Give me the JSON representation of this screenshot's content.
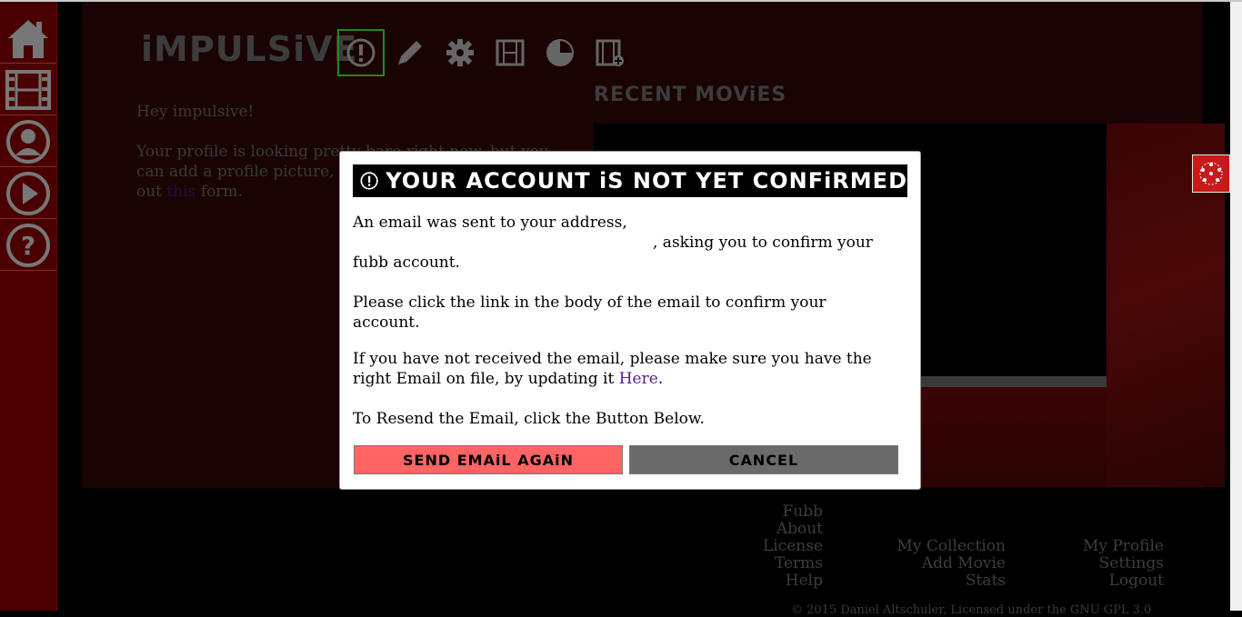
{
  "sidebar": {
    "items": [
      {
        "icon": "home-icon"
      },
      {
        "icon": "film-icon"
      },
      {
        "icon": "user-icon"
      },
      {
        "icon": "play-icon"
      },
      {
        "icon": "help-icon"
      }
    ]
  },
  "header": {
    "logo_text": "iMPULSiVE",
    "nav": [
      {
        "icon": "alert-icon",
        "active": true
      },
      {
        "icon": "pencil-icon"
      },
      {
        "icon": "gear-icon"
      },
      {
        "icon": "film-icon"
      },
      {
        "icon": "pie-chart-icon"
      },
      {
        "icon": "add-film-icon"
      }
    ]
  },
  "main": {
    "greeting": "Hey impulsive!",
    "profile_msg_1": "Your profile is looking pretty bare right now, but you can add a profile picture,",
    "profile_msg_link": "this",
    "profile_msg_pre": "out",
    "profile_msg_post": "form.",
    "recent_title": "RECENT MOViES"
  },
  "modal": {
    "title": "YOUR ACCOUNT iS NOT YET CONFiRMED",
    "p1_line1": "An email was sent to your address,",
    "p1_line2": ", asking you to confirm your",
    "p1_line3": "fubb account.",
    "p2": "Please click the link in the body of the email to confirm your account.",
    "p3_pre": "If you have not received the email, please make sure you have the right Email on file, by updating it",
    "p3_link": "Here",
    "p3_post": ".",
    "p4": "To Resend the Email, click the Button Below.",
    "send_label": "SEND EMAiL AGAiN",
    "cancel_label": "CANCEL"
  },
  "footer": {
    "col1": [
      "Fubb",
      "About",
      "License",
      "Terms",
      "Help"
    ],
    "col2": [
      "My Collection",
      "Add Movie",
      "Stats"
    ],
    "col3": [
      "My Profile",
      "Settings",
      "Logout"
    ],
    "copyright": "© 2015 Daniel Altschuler, Licensed under the GNU GPL 3.0"
  },
  "colors": {
    "sidebar": "#4a0000",
    "send_button": "#ff6464",
    "cancel_button": "#6a6a6a",
    "active_nav_border": "#1f8a1f",
    "link": "#5a1a8a"
  }
}
